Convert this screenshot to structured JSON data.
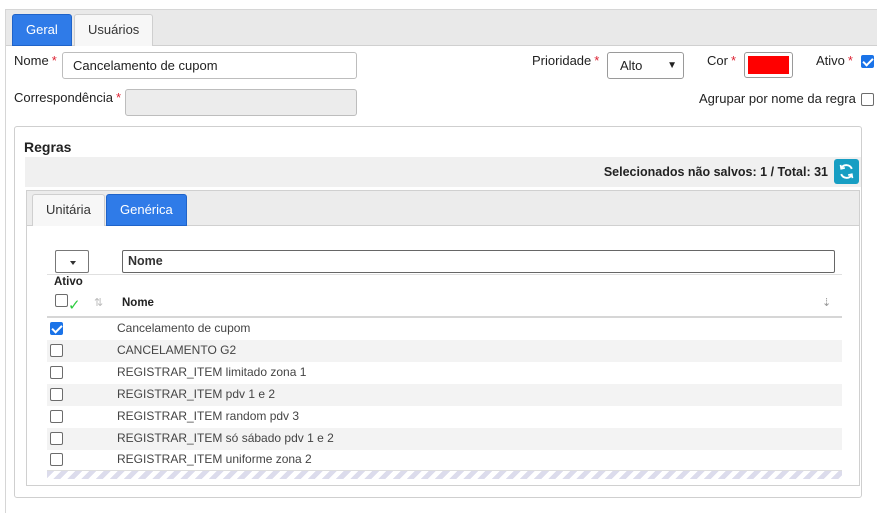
{
  "tabs": [
    {
      "label": "Geral",
      "active": true
    },
    {
      "label": "Usuários",
      "active": false
    }
  ],
  "form": {
    "nome_label": "Nome",
    "nome_value": "Cancelamento de cupom",
    "prioridade_label": "Prioridade",
    "prioridade_value": "Alto",
    "cor_label": "Cor",
    "cor_value": "#ff0000",
    "ativo_label": "Ativo",
    "ativo_checked": true,
    "correspondencia_label": "Correspondência",
    "correspondencia_value": "",
    "agrupar_label": "Agrupar por nome da regra",
    "agrupar_checked": false,
    "required_mark": "*"
  },
  "regras": {
    "title": "Regras",
    "status_text": "Selecionados não salvos: 1 /  Total: 31",
    "refresh_icon": "refresh-icon",
    "inner_tabs": [
      {
        "label": "Unitária",
        "active": false
      },
      {
        "label": "Genérica",
        "active": true
      }
    ],
    "filter_placeholder": "Nome",
    "columns": {
      "ativo": "Ativo",
      "nome": "Nome"
    },
    "rows": [
      {
        "name": "Cancelamento de cupom",
        "checked": true
      },
      {
        "name": "CANCELAMENTO G2",
        "checked": false
      },
      {
        "name": "REGISTRAR_ITEM limitado zona 1",
        "checked": false
      },
      {
        "name": "REGISTRAR_ITEM pdv 1 e 2",
        "checked": false
      },
      {
        "name": "REGISTRAR_ITEM random pdv 3",
        "checked": false
      },
      {
        "name": "REGISTRAR_ITEM só sábado pdv 1 e 2",
        "checked": false
      },
      {
        "name": "REGISTRAR_ITEM uniforme zona 2",
        "checked": false
      }
    ]
  },
  "colors": {
    "accent": "#2f7be8",
    "refresh": "#179ec3",
    "required": "#dd2233"
  }
}
